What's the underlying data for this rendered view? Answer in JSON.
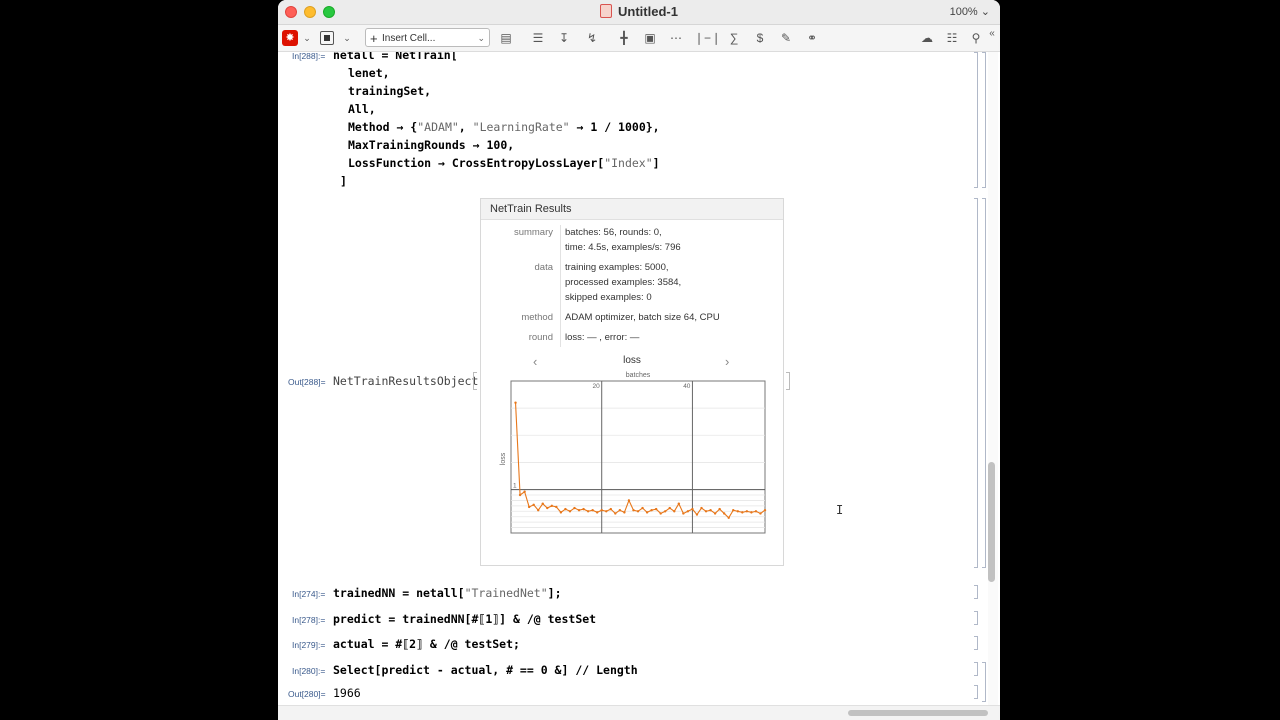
{
  "window": {
    "title": "Untitled-1",
    "zoom": "100%"
  },
  "toolbar": {
    "insert_cell_label": "Insert Cell..."
  },
  "cells": {
    "in288_label": "In[288]:=",
    "in288_lines": [
      "netall = NetTrain[",
      "lenet,",
      "trainingSet,",
      "All,",
      "MaxTrainingRounds → 100,",
      "LossFunction → CrossEntropyLossLayer[",
      "]"
    ],
    "method_prefix": "Method → {",
    "method_str1": "\"ADAM\"",
    "method_comma": ", ",
    "method_str2": "\"LearningRate\"",
    "method_suffix": " → 1 / 1000},",
    "loss_str": "\"Index\"",
    "loss_close": "]",
    "out288_label": "Out[288]=",
    "out288_head": "NetTrainResultsObject",
    "in274_label": "In[274]:=",
    "in274_code_a": "trainedNN = netall[",
    "in274_str": "\"TrainedNet\"",
    "in274_code_b": "];",
    "in278_label": "In[278]:=",
    "in278_code": "predict = trainedNN[#⟦1⟧] & /@ testSet",
    "in279_label": "In[279]:=",
    "in279_code": "actual = #⟦2⟧ & /@ testSet;",
    "in280_label": "In[280]:=",
    "in280_code": "Select[predict - actual, # == 0 &] // Length",
    "out280_label": "Out[280]=",
    "out280_value": "1966"
  },
  "results_panel": {
    "header": "NetTrain Results",
    "summary_key": "summary",
    "summary_line1": "batches: 56, rounds: 0,",
    "summary_line2": "time: 4.5s, examples/s: 796",
    "data_key": "data",
    "data_line1": "training examples: 5000,",
    "data_line2": "processed examples: 3584,",
    "data_line3": "skipped examples: 0",
    "method_key": "method",
    "method_val": "ADAM optimizer, batch size 64, CPU",
    "round_key": "round",
    "round_val": "loss: — , error: —",
    "nav_prev": "‹",
    "nav_next": "›",
    "plot_title": "loss"
  },
  "chart_data": {
    "type": "line",
    "title": "loss",
    "xlabel": "batches",
    "ylabel": "loss",
    "x_ticks": [
      "20",
      "40"
    ],
    "y_ticks": [
      "1"
    ],
    "xlim": [
      0,
      56
    ],
    "color": "#e8771a",
    "series": [
      {
        "x": [
          1,
          2,
          3,
          4,
          5,
          6,
          7,
          8,
          9,
          10,
          11,
          12,
          13,
          14,
          15,
          16,
          17,
          18,
          19,
          20,
          21,
          22,
          23,
          24,
          25,
          26,
          27,
          28,
          29,
          30,
          31,
          32,
          33,
          34,
          35,
          36,
          37,
          38,
          39,
          40,
          41,
          42,
          43,
          44,
          45,
          46,
          47,
          48,
          49,
          50,
          51,
          52,
          53,
          54,
          55,
          56
        ],
        "y": [
          2.6,
          0.9,
          0.96,
          0.68,
          0.72,
          0.62,
          0.74,
          0.66,
          0.7,
          0.68,
          0.58,
          0.64,
          0.6,
          0.66,
          0.62,
          0.64,
          0.6,
          0.62,
          0.58,
          0.62,
          0.6,
          0.64,
          0.56,
          0.62,
          0.58,
          0.8,
          0.62,
          0.6,
          0.66,
          0.58,
          0.62,
          0.64,
          0.56,
          0.6,
          0.66,
          0.6,
          0.74,
          0.56,
          0.6,
          0.64,
          0.54,
          0.66,
          0.6,
          0.62,
          0.56,
          0.64,
          0.56,
          0.48,
          0.62,
          0.6,
          0.58,
          0.6,
          0.58,
          0.6,
          0.56,
          0.62
        ]
      }
    ]
  }
}
